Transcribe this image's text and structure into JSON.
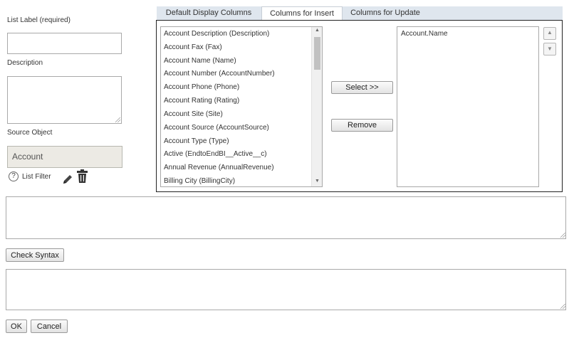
{
  "form": {
    "list_label": "List Label (required)",
    "list_label_value": "",
    "description_label": "Description",
    "description_value": "",
    "source_object_label": "Source Object",
    "source_object_value": "Account",
    "help_glyph": "?",
    "list_filter_label": "List Filter"
  },
  "tabs": [
    {
      "label": "Default Display Columns",
      "active": false
    },
    {
      "label": "Columns for Insert",
      "active": true
    },
    {
      "label": "Columns for Update",
      "active": false
    }
  ],
  "available_columns": [
    "Account Description (Description)",
    "Account Fax (Fax)",
    "Account Name (Name)",
    "Account Number (AccountNumber)",
    "Account Phone (Phone)",
    "Account Rating (Rating)",
    "Account Site (Site)",
    "Account Source (AccountSource)",
    "Account Type (Type)",
    "Active (EndtoEndBI__Active__c)",
    "Annual Revenue (AnnualRevenue)",
    "Billing City (BillingCity)"
  ],
  "selected_columns": [
    "Account.Name"
  ],
  "buttons": {
    "select": "Select >>",
    "remove": "Remove",
    "check_syntax": "Check Syntax",
    "ok": "OK",
    "cancel": "Cancel"
  },
  "query_text": "",
  "syntax_result": "",
  "icons": {
    "help": "help-circle-icon",
    "edit": "pencil-icon",
    "delete": "trash-icon",
    "up": "move-up-icon",
    "down": "move-down-icon"
  }
}
